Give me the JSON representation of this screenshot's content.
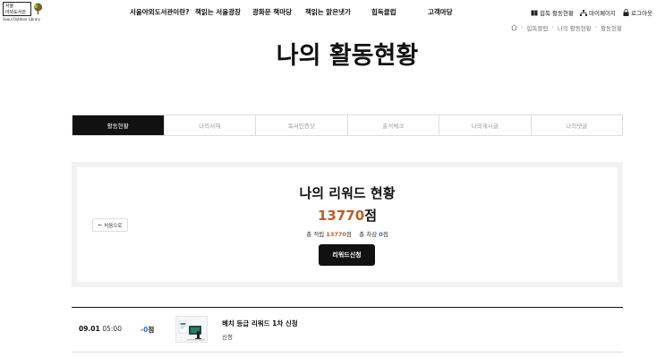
{
  "logo": {
    "line1": "서울",
    "line2": "야외도서관",
    "english": "Seoul Outdoor Library"
  },
  "gnb": {
    "items": [
      {
        "label": "서울야외도서관이란?"
      },
      {
        "label": "책읽는 서울광장"
      },
      {
        "label": "광화문 책마당"
      },
      {
        "label": "책읽는 맑은냇가"
      },
      {
        "label": "힙독클럽"
      },
      {
        "label": "고객마당"
      }
    ]
  },
  "util": {
    "activity": "힙독 활동현황",
    "mypage": "마이페이지",
    "logout": "로그아웃"
  },
  "breadcrumb": {
    "items": [
      "힙독클럽",
      "나의 활동현황",
      "활동현황"
    ]
  },
  "page": {
    "title": "나의 활동현황"
  },
  "tabs": [
    {
      "label": "활동현황",
      "active": true
    },
    {
      "label": "나의서재",
      "active": false
    },
    {
      "label": "독서인증샷",
      "active": false
    },
    {
      "label": "출석체크",
      "active": false
    },
    {
      "label": "나의게시글",
      "active": false
    },
    {
      "label": "나의댓글",
      "active": false
    }
  ],
  "reward": {
    "back_label": "처음으로",
    "title": "나의 리워드 현황",
    "score": "13770",
    "score_unit": "점",
    "earn_label": "총 적립",
    "earn_value": "13770",
    "earn_unit": "점",
    "deduct_label": "총 차감",
    "deduct_value": "0",
    "deduct_unit": "점",
    "apply_button": "리워드신청",
    "accent_color": "#b8602a",
    "blue_color": "#2a6fd0"
  },
  "history": [
    {
      "date": "09.01",
      "time": "05:00",
      "point": "-0",
      "point_unit": "점",
      "title": "헤치 등급 리워드 1차 신청",
      "status": "신청"
    }
  ]
}
